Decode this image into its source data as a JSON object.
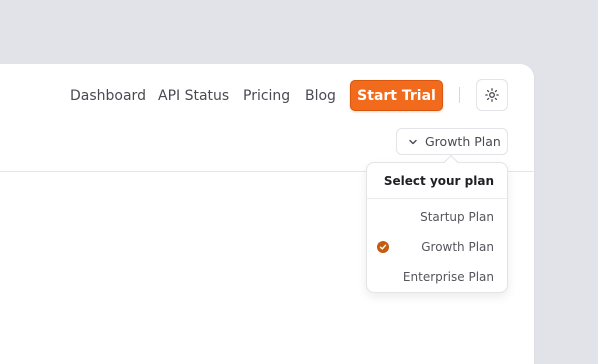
{
  "nav": {
    "links": [
      "Dashboard",
      "API Status",
      "Pricing",
      "Blog"
    ],
    "cta_label": "Start Trial",
    "theme_icon": "sun-icon"
  },
  "plan_selector": {
    "selected_label": "Growth Plan",
    "icon": "chevron-down-icon"
  },
  "dropdown": {
    "title": "Select your plan",
    "options": [
      {
        "label": "Startup Plan",
        "selected": false
      },
      {
        "label": "Growth Plan",
        "selected": true
      },
      {
        "label": "Enterprise Plan",
        "selected": false
      }
    ],
    "check_icon": "checkmark-icon"
  },
  "colors": {
    "accent": "#f26a1b",
    "check": "#c55a11",
    "background": "#e2e3e8"
  }
}
